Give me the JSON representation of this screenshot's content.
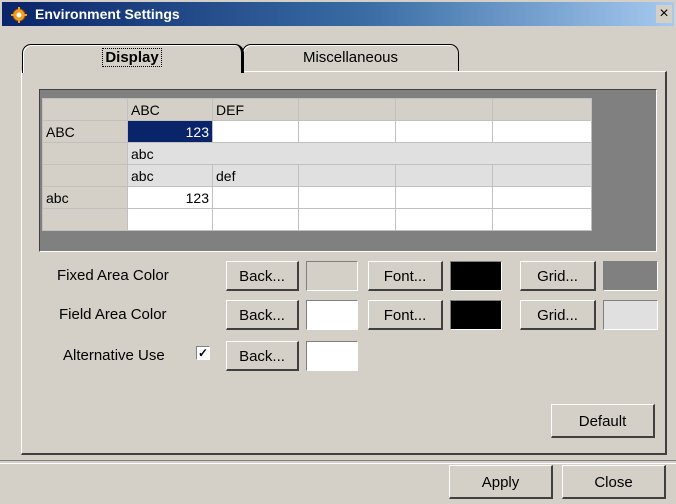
{
  "window": {
    "title": "Environment Settings",
    "close_glyph": "×",
    "icon": "gear-icon"
  },
  "tabs": [
    {
      "label": "Display",
      "active": true
    },
    {
      "label": "Miscellaneous",
      "active": false
    }
  ],
  "preview_grid": {
    "rows": [
      [
        "",
        "ABC",
        "DEF",
        "",
        "",
        ""
      ],
      [
        "ABC",
        "123",
        "",
        "",
        "",
        ""
      ],
      [
        "",
        "abc",
        "",
        "",
        "",
        ""
      ],
      [
        "",
        "abc",
        "def",
        "",
        "",
        ""
      ],
      [
        "abc",
        "123",
        "",
        "",
        "",
        ""
      ],
      [
        "",
        "",
        "",
        "",
        "",
        ""
      ]
    ]
  },
  "settings": {
    "fixed_area": {
      "label": "Fixed Area Color",
      "back_label": "Back...",
      "back_color": "#d4d0c8",
      "font_label": "Font...",
      "font_color": "#000000",
      "grid_label": "Grid...",
      "grid_color": "#808080"
    },
    "field_area": {
      "label": "Field Area Color",
      "back_label": "Back...",
      "back_color": "#ffffff",
      "font_label": "Font...",
      "font_color": "#000000",
      "grid_label": "Grid...",
      "grid_color": "#e0e0e0"
    },
    "alternative": {
      "label": "Alternative Use",
      "checked": true,
      "check_glyph": "✓",
      "back_label": "Back...",
      "back_color": "#ffffff"
    }
  },
  "buttons": {
    "default_label": "Default",
    "apply_label": "Apply",
    "close_label": "Close"
  }
}
